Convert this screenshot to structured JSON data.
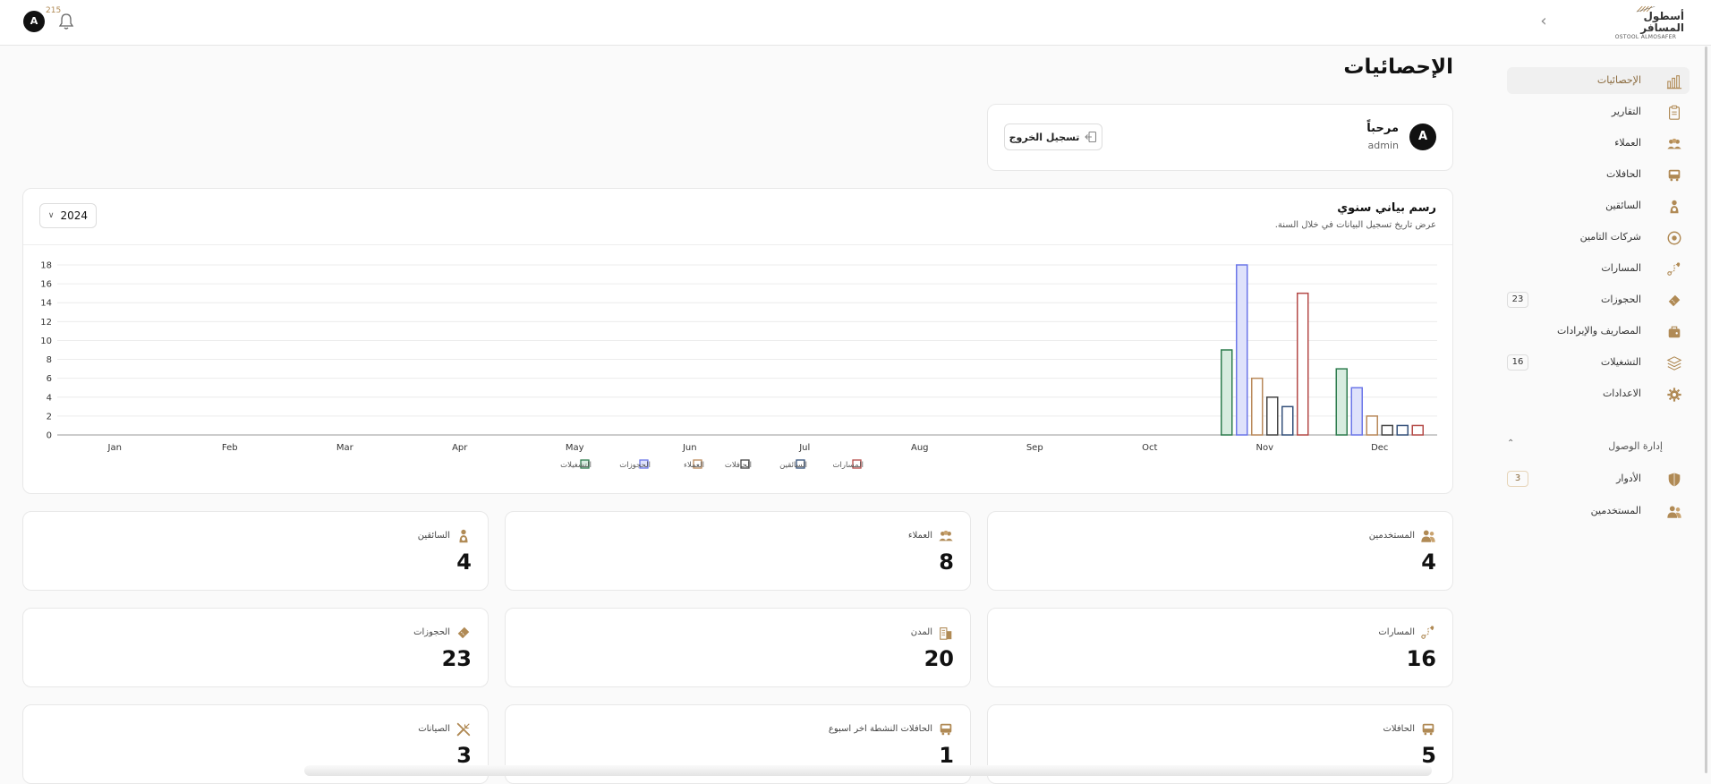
{
  "app": {
    "logo_text_ar": "أسطول المسافر",
    "logo_text_en": "OSTOOL ALMOSAFER",
    "notification_count": "215",
    "user_initial": "A"
  },
  "colors": {
    "accent": "#b08a55",
    "green": "#2f7d4f",
    "blue": "#6b76e8",
    "orange": "#b9895a",
    "dark": "#444444",
    "navy": "#34507a",
    "red": "#b44a47"
  },
  "sidebar": {
    "items": [
      {
        "label": "الإحصائيات",
        "icon": "chart-icon",
        "active": true,
        "badge": ""
      },
      {
        "label": "التقارير",
        "icon": "clipboard-icon",
        "active": false,
        "badge": ""
      },
      {
        "label": "العملاء",
        "icon": "users-group-icon",
        "active": false,
        "badge": ""
      },
      {
        "label": "الحافلات",
        "icon": "bus-icon",
        "active": false,
        "badge": ""
      },
      {
        "label": "السائقين",
        "icon": "driver-icon",
        "active": false,
        "badge": ""
      },
      {
        "label": "شركات التامين",
        "icon": "shield-circle-icon",
        "active": false,
        "badge": ""
      },
      {
        "label": "المسارات",
        "icon": "route-icon",
        "active": false,
        "badge": ""
      },
      {
        "label": "الحجوزات",
        "icon": "ticket-icon",
        "active": false,
        "badge": "23"
      },
      {
        "label": "المصاريف والإيرادات",
        "icon": "wallet-icon",
        "active": false,
        "badge": ""
      },
      {
        "label": "التشغيلات",
        "icon": "layers-icon",
        "active": false,
        "badge": "16"
      },
      {
        "label": "الاعدادات",
        "icon": "gear-icon",
        "active": false,
        "badge": ""
      }
    ],
    "access_section": {
      "label": "إدارة الوصول",
      "items": [
        {
          "label": "الأدوار",
          "icon": "shield-icon",
          "badge": "3"
        },
        {
          "label": "المستخدمين",
          "icon": "users-icon",
          "badge": ""
        }
      ]
    }
  },
  "page": {
    "title": "الإحصائيات"
  },
  "welcome": {
    "title": "مرحباً",
    "username": "admin",
    "avatar": "A",
    "logout_label": "تسجيل الخروج"
  },
  "chart_card": {
    "title": "رسم بياني سنوي",
    "subtitle": "عرض تاريخ تسجيل البيانات في خلال السنة.",
    "year": "2024"
  },
  "chart_data": {
    "type": "bar",
    "title": "رسم بياني سنوي",
    "categories": [
      "Jan",
      "Feb",
      "Mar",
      "Apr",
      "May",
      "Jun",
      "Jul",
      "Aug",
      "Sep",
      "Oct",
      "Nov",
      "Dec"
    ],
    "ylim": [
      0,
      18
    ],
    "yticks": [
      0,
      2,
      4,
      6,
      8,
      10,
      12,
      14,
      16,
      18
    ],
    "grid": true,
    "legend_position": "bottom",
    "series": [
      {
        "name": "التشغيلات",
        "color": "#2f7d4f",
        "fill": "#d7ecdf",
        "values": [
          0,
          0,
          0,
          0,
          0,
          0,
          0,
          0,
          0,
          0,
          9,
          7
        ]
      },
      {
        "name": "الحجوزات",
        "color": "#6b76e8",
        "fill": "#dfe2fb",
        "values": [
          0,
          0,
          0,
          0,
          0,
          0,
          0,
          0,
          0,
          0,
          18,
          5
        ]
      },
      {
        "name": "العملاء",
        "color": "#b9895a",
        "fill": "#ffffff",
        "values": [
          0,
          0,
          0,
          0,
          0,
          0,
          0,
          0,
          0,
          0,
          6,
          2
        ]
      },
      {
        "name": "الحافلات",
        "color": "#444444",
        "fill": "#ffffff",
        "values": [
          0,
          0,
          0,
          0,
          0,
          0,
          0,
          0,
          0,
          0,
          4,
          1
        ]
      },
      {
        "name": "السائقين",
        "color": "#34507a",
        "fill": "#ffffff",
        "values": [
          0,
          0,
          0,
          0,
          0,
          0,
          0,
          0,
          0,
          0,
          3,
          1
        ]
      },
      {
        "name": "المسارات",
        "color": "#b44a47",
        "fill": "#ffffff",
        "values": [
          0,
          0,
          0,
          0,
          0,
          0,
          0,
          0,
          0,
          0,
          15,
          1
        ]
      }
    ]
  },
  "stats": [
    {
      "label": "المستخدمين",
      "value": "4",
      "icon": "users-icon"
    },
    {
      "label": "العملاء",
      "value": "8",
      "icon": "users-group-icon"
    },
    {
      "label": "السائقين",
      "value": "4",
      "icon": "driver-icon"
    },
    {
      "label": "المسارات",
      "value": "16",
      "icon": "route-icon"
    },
    {
      "label": "المدن",
      "value": "20",
      "icon": "building-icon"
    },
    {
      "label": "الحجوزات",
      "value": "23",
      "icon": "ticket-icon"
    },
    {
      "label": "الحافلات",
      "value": "5",
      "icon": "bus-icon"
    },
    {
      "label": "الحافلات النشطة اخر اسبوع",
      "value": "1",
      "icon": "bus-icon"
    },
    {
      "label": "الصيانات",
      "value": "3",
      "icon": "wrench-icon"
    }
  ]
}
